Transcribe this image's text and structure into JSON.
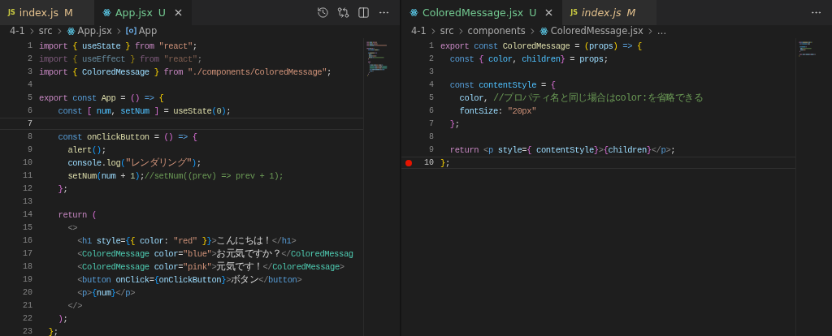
{
  "editors": [
    {
      "tabs": [
        {
          "kind": "js",
          "icon_label": "JS",
          "label": "index.js",
          "status": "M",
          "color": "#e2c08d",
          "selected": false,
          "preview": false
        },
        {
          "kind": "react",
          "label": "App.jsx",
          "status": "U",
          "color": "#73c991",
          "selected": true,
          "preview": false
        }
      ],
      "breadcrumbs": [
        {
          "kind": "folder",
          "label": "4-1"
        },
        {
          "kind": "folder",
          "label": "src"
        },
        {
          "kind": "file",
          "label": "App.jsx"
        },
        {
          "kind": "symbol",
          "label": "App"
        }
      ],
      "lines": [
        {
          "number": "1",
          "tokens": [
            {
              "text": "import ",
              "kind": "kw"
            },
            {
              "text": "{",
              "kind": "b1"
            },
            {
              "text": " useState ",
              "kind": "var"
            },
            {
              "text": "}",
              "kind": "b1"
            },
            {
              "text": " from ",
              "kind": "kw"
            },
            {
              "text": "\"react\"",
              "kind": "str"
            },
            {
              "text": ";",
              "kind": "plain"
            }
          ]
        },
        {
          "number": "2",
          "faded": true,
          "tokens": [
            {
              "text": "import ",
              "kind": "kw"
            },
            {
              "text": "{",
              "kind": "b1"
            },
            {
              "text": " useEffect ",
              "kind": "var"
            },
            {
              "text": "}",
              "kind": "b1"
            },
            {
              "text": " from ",
              "kind": "kw"
            },
            {
              "text": "\"react\"",
              "kind": "str"
            },
            {
              "text": ";",
              "kind": "plain"
            }
          ]
        },
        {
          "number": "3",
          "tokens": [
            {
              "text": "import ",
              "kind": "kw"
            },
            {
              "text": "{",
              "kind": "b1"
            },
            {
              "text": " ColoredMessage ",
              "kind": "var"
            },
            {
              "text": "}",
              "kind": "b1"
            },
            {
              "text": " from ",
              "kind": "kw"
            },
            {
              "text": "\"./components/ColoredMessage\"",
              "kind": "str"
            },
            {
              "text": ";",
              "kind": "plain"
            }
          ]
        },
        {
          "number": "4"
        },
        {
          "number": "5",
          "tokens": [
            {
              "text": "export ",
              "kind": "kw"
            },
            {
              "text": "const ",
              "kind": "decl"
            },
            {
              "text": "App",
              "kind": "fn"
            },
            {
              "text": " = ",
              "kind": "plain"
            },
            {
              "text": "()",
              "kind": "b2"
            },
            {
              "text": " => ",
              "kind": "decl"
            },
            {
              "text": "{",
              "kind": "b1"
            }
          ]
        },
        {
          "number": "6",
          "tokens": [
            {
              "text": "    const ",
              "kind": "decl"
            },
            {
              "text": "[",
              "kind": "b2"
            },
            {
              "text": " num",
              "kind": "const"
            },
            {
              "text": ", ",
              "kind": "plain"
            },
            {
              "text": "setNum ",
              "kind": "const"
            },
            {
              "text": "]",
              "kind": "b2"
            },
            {
              "text": " = ",
              "kind": "plain"
            },
            {
              "text": "useState",
              "kind": "fn"
            },
            {
              "text": "(",
              "kind": "b3"
            },
            {
              "text": "0",
              "kind": "num"
            },
            {
              "text": ")",
              "kind": "b3"
            },
            {
              "text": ";",
              "kind": "plain"
            }
          ]
        },
        {
          "number": "7",
          "current": true
        },
        {
          "number": "8",
          "tokens": [
            {
              "text": "    const ",
              "kind": "decl"
            },
            {
              "text": "onClickButton",
              "kind": "fn"
            },
            {
              "text": " = ",
              "kind": "plain"
            },
            {
              "text": "()",
              "kind": "b2"
            },
            {
              "text": " => ",
              "kind": "decl"
            },
            {
              "text": "{",
              "kind": "b2"
            }
          ]
        },
        {
          "number": "9",
          "tokens": [
            {
              "text": "      alert",
              "kind": "fn"
            },
            {
              "text": "()",
              "kind": "b3"
            },
            {
              "text": ";",
              "kind": "plain"
            }
          ]
        },
        {
          "number": "10",
          "tokens": [
            {
              "text": "      console",
              "kind": "var"
            },
            {
              "text": ".",
              "kind": "plain"
            },
            {
              "text": "log",
              "kind": "fn"
            },
            {
              "text": "(",
              "kind": "b3"
            },
            {
              "text": "\"レンダリング\"",
              "kind": "str"
            },
            {
              "text": ")",
              "kind": "b3"
            },
            {
              "text": ";",
              "kind": "plain"
            }
          ]
        },
        {
          "number": "11",
          "tokens": [
            {
              "text": "      setNum",
              "kind": "fn"
            },
            {
              "text": "(",
              "kind": "b3"
            },
            {
              "text": "num",
              "kind": "var"
            },
            {
              "text": " + ",
              "kind": "plain"
            },
            {
              "text": "1",
              "kind": "num"
            },
            {
              "text": ")",
              "kind": "b3"
            },
            {
              "text": ";",
              "kind": "plain"
            },
            {
              "text": "//setNum((prev) => prev + 1);",
              "kind": "comment"
            }
          ]
        },
        {
          "number": "12",
          "tokens": [
            {
              "text": "    }",
              "kind": "b2"
            },
            {
              "text": ";",
              "kind": "plain"
            }
          ]
        },
        {
          "number": "13"
        },
        {
          "number": "14",
          "tokens": [
            {
              "text": "    return ",
              "kind": "kw"
            },
            {
              "text": "(",
              "kind": "b2"
            }
          ]
        },
        {
          "number": "15",
          "tokens": [
            {
              "text": "      <>",
              "kind": "angle"
            }
          ]
        },
        {
          "number": "16",
          "tokens": [
            {
              "text": "        <",
              "kind": "angle"
            },
            {
              "text": "h1",
              "kind": "tag"
            },
            {
              "text": " style",
              "kind": "var"
            },
            {
              "text": "=",
              "kind": "plain"
            },
            {
              "text": "{",
              "kind": "b3"
            },
            {
              "text": "{",
              "kind": "b1"
            },
            {
              "text": " color",
              "kind": "var"
            },
            {
              "text": ": ",
              "kind": "plain"
            },
            {
              "text": "\"red\"",
              "kind": "str"
            },
            {
              "text": " }",
              "kind": "b1"
            },
            {
              "text": "}",
              "kind": "b3"
            },
            {
              "text": ">",
              "kind": "angle"
            },
            {
              "text": "こんにちは！",
              "kind": "plain"
            },
            {
              "text": "</",
              "kind": "angle"
            },
            {
              "text": "h1",
              "kind": "tag"
            },
            {
              "text": ">",
              "kind": "angle"
            }
          ]
        },
        {
          "number": "17",
          "tokens": [
            {
              "text": "        <",
              "kind": "angle"
            },
            {
              "text": "ColoredMessage",
              "kind": "comp"
            },
            {
              "text": " color",
              "kind": "var"
            },
            {
              "text": "=",
              "kind": "plain"
            },
            {
              "text": "\"blue\"",
              "kind": "str"
            },
            {
              "text": ">",
              "kind": "angle"
            },
            {
              "text": "お元気ですか？",
              "kind": "plain"
            },
            {
              "text": "</",
              "kind": "angle"
            },
            {
              "text": "ColoredMessag",
              "kind": "comp"
            }
          ]
        },
        {
          "number": "18",
          "tokens": [
            {
              "text": "        <",
              "kind": "angle"
            },
            {
              "text": "ColoredMessage",
              "kind": "comp"
            },
            {
              "text": " color",
              "kind": "var"
            },
            {
              "text": "=",
              "kind": "plain"
            },
            {
              "text": "\"pink\"",
              "kind": "str"
            },
            {
              "text": ">",
              "kind": "angle"
            },
            {
              "text": "元気です！",
              "kind": "plain"
            },
            {
              "text": "</",
              "kind": "angle"
            },
            {
              "text": "ColoredMessage",
              "kind": "comp"
            },
            {
              "text": ">",
              "kind": "angle"
            }
          ]
        },
        {
          "number": "19",
          "tokens": [
            {
              "text": "        <",
              "kind": "angle"
            },
            {
              "text": "button",
              "kind": "tag"
            },
            {
              "text": " onClick",
              "kind": "var"
            },
            {
              "text": "=",
              "kind": "plain"
            },
            {
              "text": "{",
              "kind": "b3"
            },
            {
              "text": "onClickButton",
              "kind": "var"
            },
            {
              "text": "}",
              "kind": "b3"
            },
            {
              "text": ">",
              "kind": "angle"
            },
            {
              "text": "ボタン",
              "kind": "plain"
            },
            {
              "text": "</",
              "kind": "angle"
            },
            {
              "text": "button",
              "kind": "tag"
            },
            {
              "text": ">",
              "kind": "angle"
            }
          ]
        },
        {
          "number": "20",
          "tokens": [
            {
              "text": "        <",
              "kind": "angle"
            },
            {
              "text": "p",
              "kind": "tag"
            },
            {
              "text": ">",
              "kind": "angle"
            },
            {
              "text": "{",
              "kind": "b3"
            },
            {
              "text": "num",
              "kind": "var"
            },
            {
              "text": "}",
              "kind": "b3"
            },
            {
              "text": "</",
              "kind": "angle"
            },
            {
              "text": "p",
              "kind": "tag"
            },
            {
              "text": ">",
              "kind": "angle"
            }
          ]
        },
        {
          "number": "21",
          "tokens": [
            {
              "text": "      </>",
              "kind": "angle"
            }
          ]
        },
        {
          "number": "22",
          "tokens": [
            {
              "text": "    )",
              "kind": "b2"
            },
            {
              "text": ";",
              "kind": "plain"
            }
          ]
        },
        {
          "number": "23",
          "tokens": [
            {
              "text": "  }",
              "kind": "b1"
            },
            {
              "text": ";",
              "kind": "plain"
            }
          ]
        }
      ]
    },
    {
      "tabs": [
        {
          "kind": "react",
          "label": "ColoredMessage.jsx",
          "status": "U",
          "color": "#73c991",
          "selected": true,
          "preview": false
        },
        {
          "kind": "js",
          "icon_label": "JS",
          "label": "index.js",
          "status": "M",
          "color": "#e2c08d",
          "selected": false,
          "preview": true
        }
      ],
      "breadcrumbs": [
        {
          "kind": "folder",
          "label": "4-1"
        },
        {
          "kind": "folder",
          "label": "src"
        },
        {
          "kind": "folder",
          "label": "components"
        },
        {
          "kind": "file",
          "label": "ColoredMessage.jsx"
        },
        {
          "kind": "more",
          "label": "…"
        }
      ],
      "lines": [
        {
          "number": "1",
          "tokens": [
            {
              "text": "export ",
              "kind": "kw"
            },
            {
              "text": "const ",
              "kind": "decl"
            },
            {
              "text": "ColoredMessage",
              "kind": "fn"
            },
            {
              "text": " = ",
              "kind": "plain"
            },
            {
              "text": "(",
              "kind": "b1"
            },
            {
              "text": "props",
              "kind": "var"
            },
            {
              "text": ")",
              "kind": "b1"
            },
            {
              "text": " => ",
              "kind": "decl"
            },
            {
              "text": "{",
              "kind": "b1"
            }
          ]
        },
        {
          "number": "2",
          "tokens": [
            {
              "text": "  const ",
              "kind": "decl"
            },
            {
              "text": "{",
              "kind": "b2"
            },
            {
              "text": " color",
              "kind": "const"
            },
            {
              "text": ", ",
              "kind": "plain"
            },
            {
              "text": "children",
              "kind": "const"
            },
            {
              "text": "}",
              "kind": "b2"
            },
            {
              "text": " = ",
              "kind": "plain"
            },
            {
              "text": "props",
              "kind": "var"
            },
            {
              "text": ";",
              "kind": "plain"
            }
          ]
        },
        {
          "number": "3"
        },
        {
          "number": "4",
          "tokens": [
            {
              "text": "  const ",
              "kind": "decl"
            },
            {
              "text": "contentStyle",
              "kind": "const"
            },
            {
              "text": " = ",
              "kind": "plain"
            },
            {
              "text": "{",
              "kind": "b2"
            }
          ]
        },
        {
          "number": "5",
          "tokens": [
            {
              "text": "    color",
              "kind": "var"
            },
            {
              "text": ", ",
              "kind": "plain"
            },
            {
              "text": "//プロパティ名と同じ場合はcolor:を省略できる",
              "kind": "comment"
            }
          ]
        },
        {
          "number": "6",
          "tokens": [
            {
              "text": "    fontSize",
              "kind": "var"
            },
            {
              "text": ": ",
              "kind": "plain"
            },
            {
              "text": "\"20px\"",
              "kind": "str"
            }
          ]
        },
        {
          "number": "7",
          "tokens": [
            {
              "text": "  }",
              "kind": "b2"
            },
            {
              "text": ";",
              "kind": "plain"
            }
          ]
        },
        {
          "number": "8"
        },
        {
          "number": "9",
          "tokens": [
            {
              "text": "  return ",
              "kind": "kw"
            },
            {
              "text": "<",
              "kind": "angle"
            },
            {
              "text": "p",
              "kind": "tag"
            },
            {
              "text": " style",
              "kind": "var"
            },
            {
              "text": "=",
              "kind": "plain"
            },
            {
              "text": "{",
              "kind": "b2"
            },
            {
              "text": " contentStyle",
              "kind": "var"
            },
            {
              "text": "}",
              "kind": "b2"
            },
            {
              "text": ">",
              "kind": "angle"
            },
            {
              "text": "{",
              "kind": "b2"
            },
            {
              "text": "children",
              "kind": "var"
            },
            {
              "text": "}",
              "kind": "b2"
            },
            {
              "text": "</",
              "kind": "angle"
            },
            {
              "text": "p",
              "kind": "tag"
            },
            {
              "text": ">",
              "kind": "angle"
            },
            {
              "text": ";",
              "kind": "plain"
            }
          ]
        },
        {
          "number": "10",
          "current": true,
          "breakpoint": true,
          "tokens": [
            {
              "text": "}",
              "kind": "b1"
            },
            {
              "text": ";",
              "kind": "plain"
            }
          ]
        }
      ]
    }
  ]
}
